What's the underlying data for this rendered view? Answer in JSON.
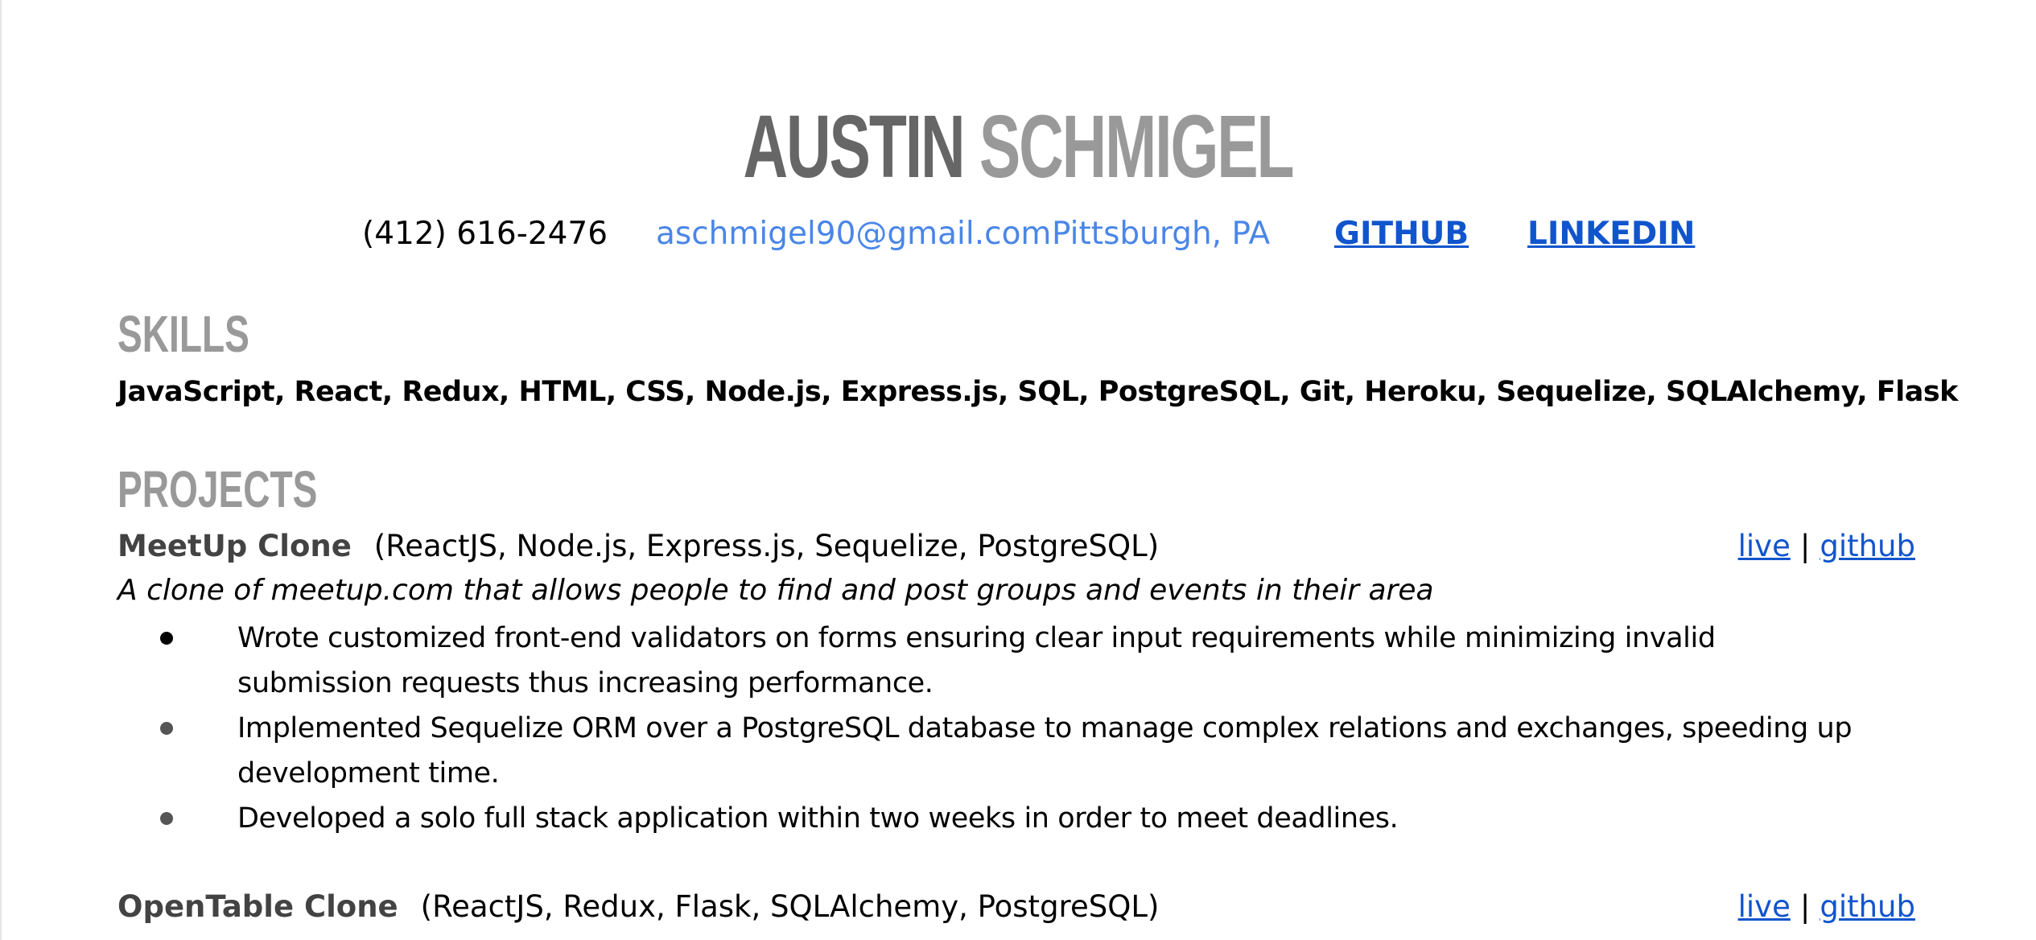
{
  "header": {
    "first_name": "AUSTIN",
    "last_name": "SCHMIGEL",
    "phone": "(412) 616-2476",
    "email": "aschmigel90@gmail.com",
    "location": "Pittsburgh, PA",
    "github_label": "GITHUB",
    "linkedin_label": "LINKEDIN"
  },
  "skills": {
    "title": "SKILLS",
    "list": "JavaScript, React, Redux, HTML, CSS, Node.js, Express.js, SQL, PostgreSQL, Git, Heroku, Sequelize, SQLAlchemy, Flask"
  },
  "projects": {
    "title": "PROJECTS",
    "items": [
      {
        "name": "MeetUp Clone",
        "tech": "(ReactJS, Node.js, Express.js, Sequelize, PostgreSQL)",
        "live_label": "live",
        "separator": "|",
        "github_label": "github",
        "description": "A clone of meetup.com that allows people to find and post groups and events in their area",
        "bullets": [
          "Wrote customized front-end validators on forms ensuring clear input requirements while minimizing invalid submission requests thus increasing performance.",
          "Implemented Sequelize ORM over a PostgreSQL database to manage complex relations and exchanges, speeding up development time.",
          "Developed a solo full stack application within two weeks in order to meet deadlines."
        ]
      },
      {
        "name": "OpenTable Clone",
        "tech": "(ReactJS, Redux, Flask, SQLAlchemy, PostgreSQL)",
        "live_label": "live",
        "separator": "|",
        "github_label": "github"
      }
    ]
  },
  "colors": {
    "name_first": "#666666",
    "name_last": "#999999",
    "section_title": "#999999",
    "contact_blue": "#4a86e8",
    "link_blue": "#1155cc",
    "project_name": "#434343"
  }
}
